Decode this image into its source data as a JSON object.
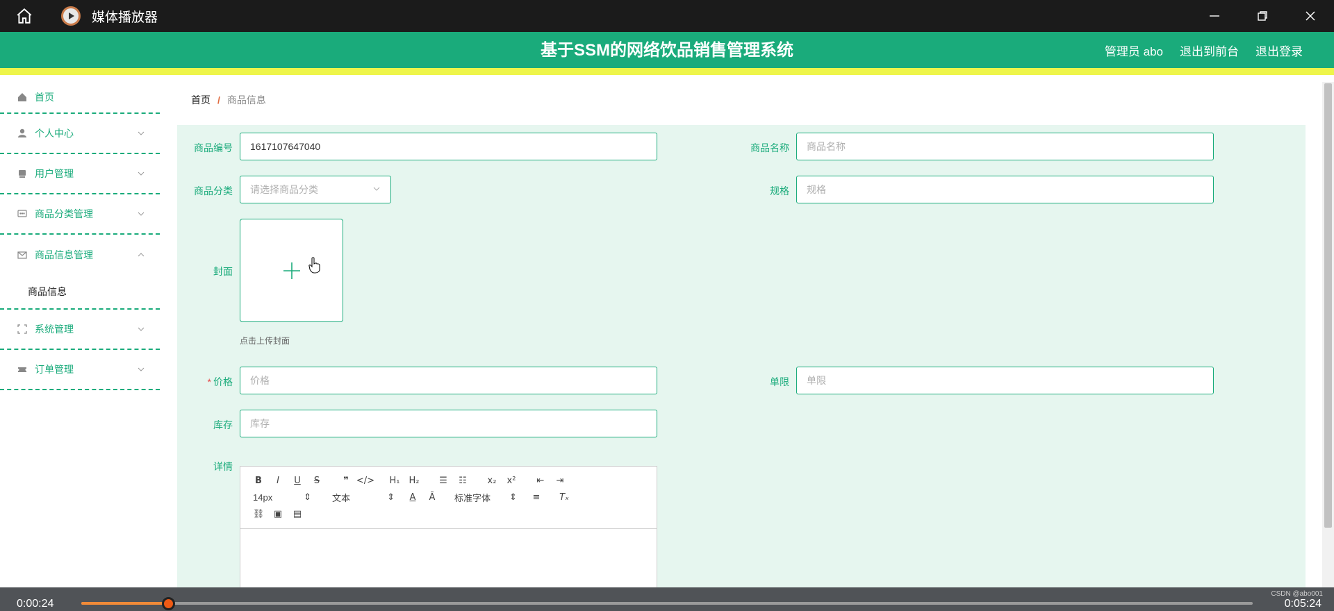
{
  "window": {
    "title": "媒体播放器"
  },
  "header": {
    "title": "基于SSM的网络饮品销售管理系统",
    "admin": "管理员 abo",
    "back_front": "退出到前台",
    "logout": "退出登录"
  },
  "sidebar": {
    "items": [
      {
        "label": "首页",
        "icon": "home-icon"
      },
      {
        "label": "个人中心",
        "icon": "user-icon"
      },
      {
        "label": "用户管理",
        "icon": "users-icon"
      },
      {
        "label": "商品分类管理",
        "icon": "chat-icon"
      },
      {
        "label": "商品信息管理",
        "icon": "mail-icon",
        "expanded": true,
        "children": [
          {
            "label": "商品信息"
          }
        ]
      },
      {
        "label": "系统管理",
        "icon": "fullscreen-icon"
      },
      {
        "label": "订单管理",
        "icon": "ticket-icon"
      }
    ]
  },
  "breadcrumb": {
    "home": "首页",
    "sep": "/",
    "current": "商品信息"
  },
  "form": {
    "code_label": "商品编号",
    "code_value": "1617107647040",
    "name_label": "商品名称",
    "name_placeholder": "商品名称",
    "category_label": "商品分类",
    "category_placeholder": "请选择商品分类",
    "spec_label": "规格",
    "spec_placeholder": "规格",
    "cover_label": "封面",
    "cover_hint": "点击上传封面",
    "price_required_mark": "*",
    "price_label": "价格",
    "price_placeholder": "价格",
    "limit_label": "单限",
    "limit_placeholder": "单限",
    "stock_label": "库存",
    "stock_placeholder": "库存",
    "detail_label": "详情"
  },
  "editor": {
    "font_size": "14px",
    "text_style": "文本",
    "font_family": "标准字体"
  },
  "player": {
    "current_time": "0:00:24",
    "total_time": "0:05:24",
    "progress": 0.074,
    "watermark": "CSDN @abo001"
  },
  "colors": {
    "accent": "#1aab7b",
    "header_border": "#eef54a",
    "form_bg": "#e6f6ef",
    "progress": "#f08a38"
  }
}
